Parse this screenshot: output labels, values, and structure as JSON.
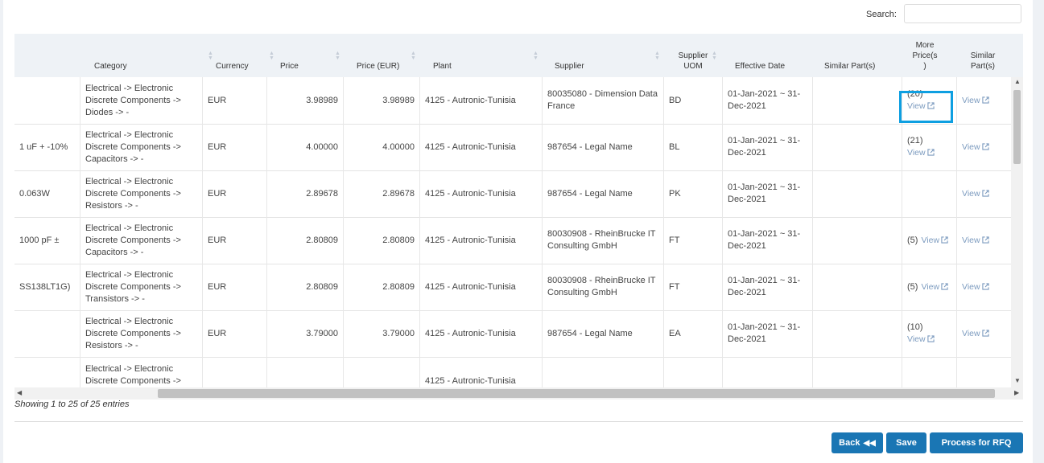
{
  "search": {
    "label": "Search:",
    "value": ""
  },
  "headers": {
    "category": "Category",
    "currency": "Currency",
    "price": "Price",
    "price_eur": "Price (EUR)",
    "plant": "Plant",
    "supplier": "Supplier",
    "supplier_uom": "Supplier UOM",
    "effective_date": "Effective Date",
    "similar_parts": "Similar Part(s)",
    "more_prices": "More Price(s )",
    "similar_parts2": "Similar Part(s)"
  },
  "rows": [
    {
      "desc": "",
      "category": "Electrical -> Electronic Discrete Components -> Diodes -> -",
      "currency": "EUR",
      "price": "3.98989",
      "price_eur": "3.98989",
      "plant": "4125 - Autronic-Tunisia",
      "supplier": "80035080 - Dimension Data France",
      "uom": "BD",
      "date": "01-Jan-2021 ~ 31-Dec-2021",
      "more_count": "(20)",
      "more_view": "View",
      "similar_view": "View"
    },
    {
      "desc": "1 uF + -10%",
      "category": "Electrical -> Electronic Discrete Components -> Capacitors -> -",
      "currency": "EUR",
      "price": "4.00000",
      "price_eur": "4.00000",
      "plant": "4125 - Autronic-Tunisia",
      "supplier": "987654 - Legal Name",
      "uom": "BL",
      "date": "01-Jan-2021 ~ 31-Dec-2021",
      "more_count": "(21)",
      "more_view": "View",
      "similar_view": "View"
    },
    {
      "desc": "0.063W",
      "category": "Electrical -> Electronic Discrete Components -> Resistors -> -",
      "currency": "EUR",
      "price": "2.89678",
      "price_eur": "2.89678",
      "plant": "4125 - Autronic-Tunisia",
      "supplier": "987654 - Legal Name",
      "uom": "PK",
      "date": "01-Jan-2021 ~ 31-Dec-2021",
      "more_count": "",
      "more_view": "",
      "similar_view": "View"
    },
    {
      "desc": "1000 pF ±",
      "category": "Electrical -> Electronic Discrete Components -> Capacitors -> -",
      "currency": "EUR",
      "price": "2.80809",
      "price_eur": "2.80809",
      "plant": "4125 - Autronic-Tunisia",
      "supplier": "80030908 - RheinBrucke IT Consulting GmbH",
      "uom": "FT",
      "date": "01-Jan-2021 ~ 31-Dec-2021",
      "more_count": "(5)",
      "more_view": "View",
      "similar_view": "View"
    },
    {
      "desc": "SS138LT1G)",
      "category": "Electrical -> Electronic Discrete Components -> Transistors -> -",
      "currency": "EUR",
      "price": "2.80809",
      "price_eur": "2.80809",
      "plant": "4125 - Autronic-Tunisia",
      "supplier": "80030908 - RheinBrucke IT Consulting GmbH",
      "uom": "FT",
      "date": "01-Jan-2021 ~ 31-Dec-2021",
      "more_count": "(5)",
      "more_view": "View",
      "similar_view": "View"
    },
    {
      "desc": "",
      "category": "Electrical -> Electronic Discrete Components -> Resistors -> -",
      "currency": "EUR",
      "price": "3.79000",
      "price_eur": "3.79000",
      "plant": "4125 - Autronic-Tunisia",
      "supplier": "987654 - Legal Name",
      "uom": "EA",
      "date": "01-Jan-2021 ~ 31-Dec-2021",
      "more_count": "(10)",
      "more_view": "View",
      "similar_view": ""
    },
    {
      "desc": "",
      "category": "Electrical -> Electronic Discrete Components ->",
      "currency": "",
      "price": "",
      "price_eur": "",
      "plant": "4125 - Autronic-Tunisia",
      "supplier": "",
      "uom": "",
      "date": "",
      "more_count": "",
      "more_view": "",
      "similar_view": ""
    }
  ],
  "info": "Showing 1 to 25 of 25 entries",
  "buttons": {
    "back": "Back",
    "save": "Save",
    "process": "Process for RFQ"
  },
  "colors": {
    "accent": "#1a76b4",
    "link": "#7c9bbf",
    "highlight": "#0e9fe1"
  },
  "icons": {
    "external_link": "external-link-icon",
    "back_double": "double-chevron-left-icon"
  }
}
